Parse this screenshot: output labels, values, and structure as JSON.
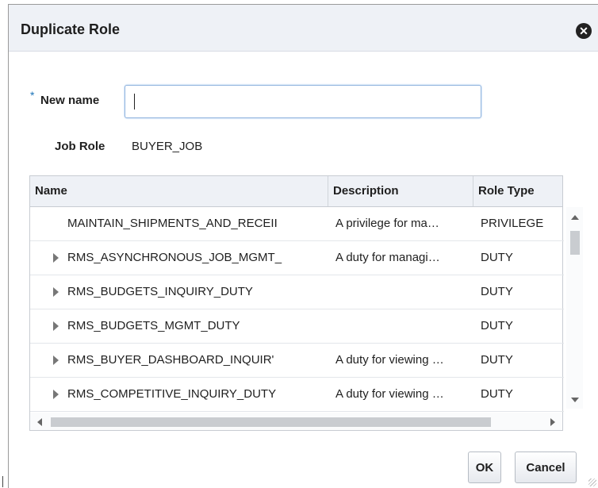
{
  "dialog": {
    "title": "Duplicate Role",
    "close_icon": "close-icon",
    "new_name_required": "*",
    "new_name_label": "New name",
    "new_name_value": "",
    "job_role_label": "Job Role",
    "job_role_value": "BUYER_JOB",
    "ok_label": "OK",
    "cancel_label": "Cancel"
  },
  "table": {
    "headers": {
      "name": "Name",
      "description": "Description",
      "role_type": "Role Type"
    },
    "rows": [
      {
        "name": "MAINTAIN_SHIPMENTS_AND_RECEII",
        "description": "A privilege for ma…",
        "type": "PRIVILEGE"
      },
      {
        "name": "RMS_ASYNCHRONOUS_JOB_MGMT_",
        "description": "A duty for managi…",
        "type": "DUTY"
      },
      {
        "name": "RMS_BUDGETS_INQUIRY_DUTY",
        "description": "",
        "type": "DUTY"
      },
      {
        "name": "RMS_BUDGETS_MGMT_DUTY",
        "description": "",
        "type": "DUTY"
      },
      {
        "name": "RMS_BUYER_DASHBOARD_INQUIR'",
        "description": "A duty for viewing …",
        "type": "DUTY"
      },
      {
        "name": "RMS_COMPETITIVE_INQUIRY_DUTY",
        "description": "A duty for viewing …",
        "type": "DUTY"
      }
    ]
  }
}
